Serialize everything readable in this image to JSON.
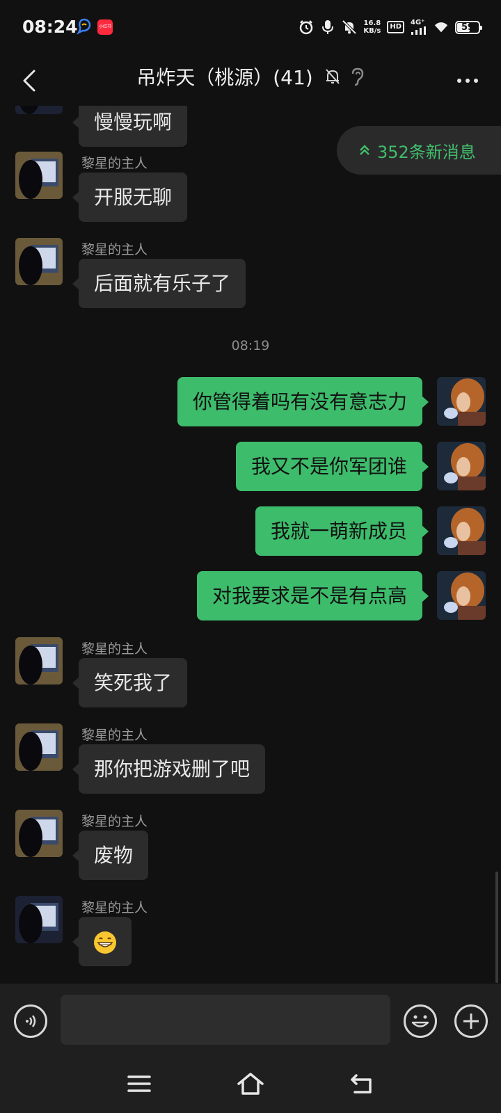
{
  "status_bar": {
    "time": "08:24",
    "app2_label": "小红书",
    "net_speed_value": "16.8",
    "net_speed_unit": "KB/s",
    "hd_label": "HD",
    "network_type": "4G⁺",
    "battery_level": "59",
    "icons": [
      "alarm-icon",
      "mic-icon",
      "mute-bell-icon",
      "signal-icon",
      "wifi-icon",
      "battery-icon"
    ]
  },
  "header": {
    "title": "吊炸天（桃源）(41)",
    "icons": [
      "back-arrow-icon",
      "muted-bell-icon",
      "ear-icon",
      "more-icon"
    ]
  },
  "new_messages": {
    "label": "352条新消息",
    "color": "#41bd6c"
  },
  "messages": [
    {
      "side": "left",
      "sender": "",
      "text": "慢慢玩啊"
    },
    {
      "side": "left",
      "sender": "黎星的主人",
      "text": "开服无聊"
    },
    {
      "side": "left",
      "sender": "黎星的主人",
      "text": "后面就有乐子了"
    },
    {
      "side": "time",
      "text": "08:19"
    },
    {
      "side": "right",
      "text": "你管得着吗有没有意志力"
    },
    {
      "side": "right",
      "text": "我又不是你军团谁"
    },
    {
      "side": "right",
      "text": "我就一萌新成员"
    },
    {
      "side": "right",
      "text": "对我要求是不是有点高"
    },
    {
      "side": "left",
      "sender": "黎星的主人",
      "text": "笑死我了"
    },
    {
      "side": "left",
      "sender": "黎星的主人",
      "text": "那你把游戏删了吧"
    },
    {
      "side": "left",
      "sender": "黎星的主人",
      "text": "废物"
    },
    {
      "side": "left",
      "sender": "黎星的主人",
      "text": "😁"
    }
  ],
  "input_bar": {
    "value": "",
    "icons": [
      "voice-icon",
      "emoji-icon",
      "plus-icon"
    ]
  },
  "nav_bar": {
    "icons": [
      "menu-icon",
      "home-icon",
      "back-icon"
    ]
  },
  "colors": {
    "background": "#111111",
    "bubble_self": "#3dbc6b",
    "bubble_other": "#2c2c2c"
  }
}
